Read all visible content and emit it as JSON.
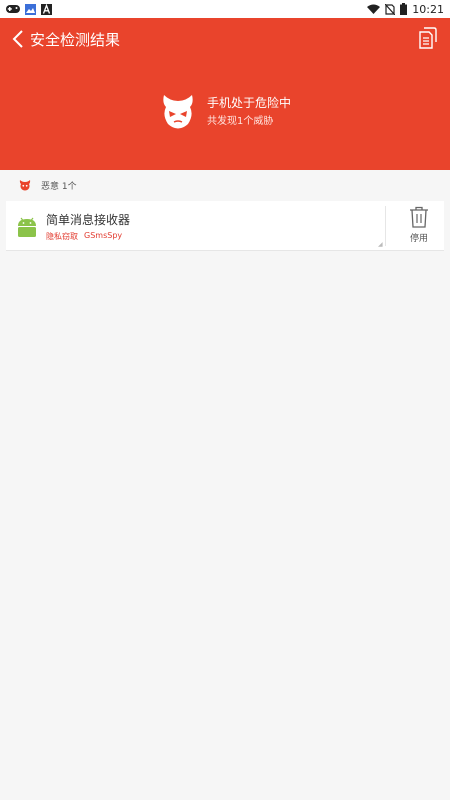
{
  "status_bar": {
    "time": "10:21",
    "left_icons": [
      "gamepad-icon",
      "image-icon",
      "a-icon"
    ],
    "right_icons": [
      "wifi-icon",
      "no-sim-icon",
      "battery-icon"
    ]
  },
  "header": {
    "title": "安全检测结果",
    "back_icon": "chevron-left-icon",
    "action_icon": "document-icon",
    "background_color": "#e9442c"
  },
  "summary": {
    "icon": "devil-face-icon",
    "title": "手机处于危险中",
    "subtitle": "共发现1个威胁"
  },
  "section": {
    "icon": "devil-badge-icon",
    "label": "恶意 1个"
  },
  "threats": [
    {
      "icon": "android-icon",
      "app_name": "简单消息接收器",
      "tags": [
        "隐私窃取",
        "GSmsSpy"
      ],
      "action_label": "停用",
      "action_icon": "trash-icon"
    }
  ],
  "colors": {
    "accent": "#e9442c",
    "tag": "#e23a2e",
    "android": "#8bc34a"
  }
}
